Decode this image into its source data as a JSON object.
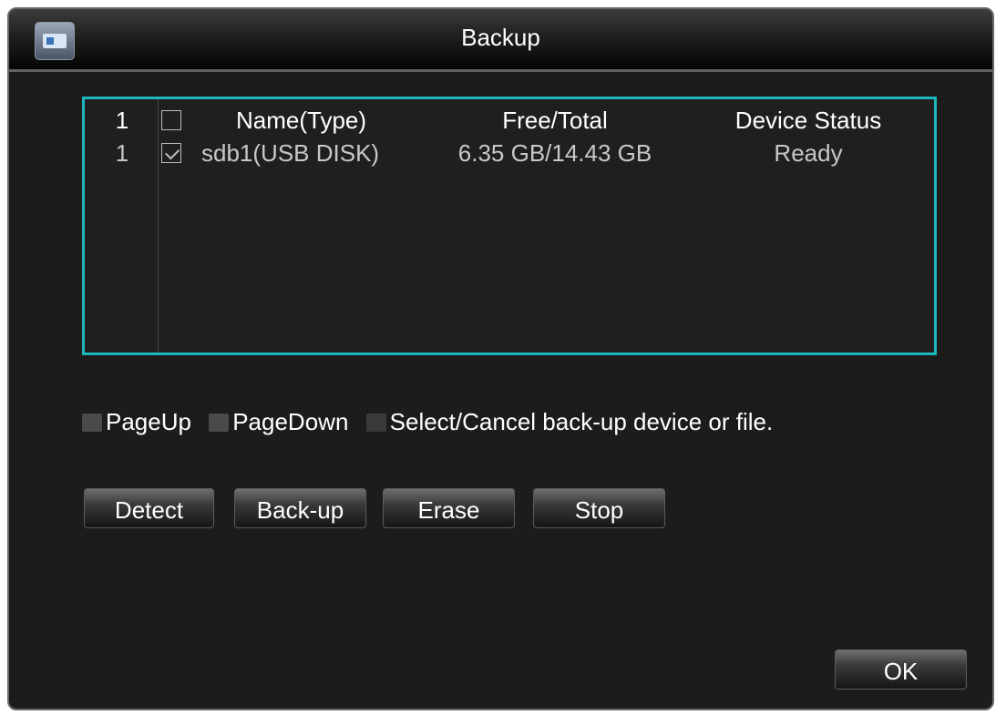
{
  "window": {
    "title": "Backup"
  },
  "table": {
    "header": {
      "index": "1",
      "name": "Name(Type)",
      "free_total": "Free/Total",
      "status": "Device Status"
    },
    "rows": [
      {
        "index": "1",
        "checked": true,
        "name": "sdb1(USB DISK)",
        "free_total": "6.35 GB/14.43 GB",
        "status": "Ready"
      }
    ]
  },
  "hints": {
    "page_up": "PageUp",
    "page_down": "PageDown",
    "select": "Select/Cancel back-up device or file."
  },
  "buttons": {
    "detect": "Detect",
    "backup": "Back-up",
    "erase": "Erase",
    "stop": "Stop",
    "ok": "OK"
  },
  "colors": {
    "accent": "#1cb7bd",
    "background": "#1c1c1c"
  }
}
